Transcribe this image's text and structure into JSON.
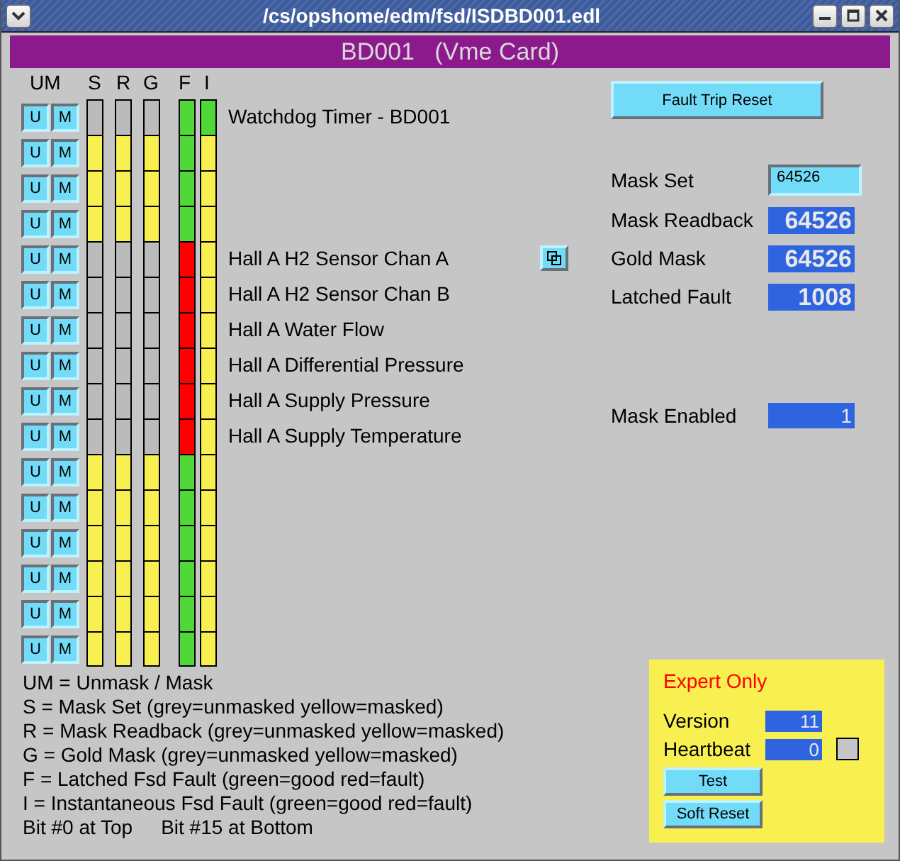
{
  "window": {
    "title": "/cs/opshome/edm/fsd/ISDBD001.edl"
  },
  "header": "BD001   (Vme Card)",
  "column_headers": [
    "UM",
    "S",
    "R",
    "G",
    "F",
    "I"
  ],
  "bits": [
    {
      "buttons": [
        "U",
        "M"
      ],
      "cells": [
        {
          "color": "#bbbbbb"
        },
        {
          "color": "#bbbbbb"
        },
        {
          "color": "#bbbbbb"
        },
        {
          "color": "#50d838"
        },
        {
          "color": "#50d838"
        }
      ],
      "label": "Watchdog Timer - BD001"
    },
    {
      "buttons": [
        "U",
        "M"
      ],
      "cells": [
        {
          "color": "#f8f050"
        },
        {
          "color": "#f8f050"
        },
        {
          "color": "#f8f050"
        },
        {
          "color": "#50d838"
        },
        {
          "color": "#f8f050"
        }
      ]
    },
    {
      "buttons": [
        "U",
        "M"
      ],
      "cells": [
        {
          "color": "#f8f050"
        },
        {
          "color": "#f8f050"
        },
        {
          "color": "#f8f050"
        },
        {
          "color": "#50d838"
        },
        {
          "color": "#f8f050"
        }
      ]
    },
    {
      "buttons": [
        "U",
        "M"
      ],
      "cells": [
        {
          "color": "#f8f050"
        },
        {
          "color": "#f8f050"
        },
        {
          "color": "#f8f050"
        },
        {
          "color": "#50d838"
        },
        {
          "color": "#f8f050"
        }
      ]
    },
    {
      "buttons": [
        "U",
        "M"
      ],
      "cells": [
        {
          "color": "#bbbbbb"
        },
        {
          "color": "#bbbbbb"
        },
        {
          "color": "#bbbbbb"
        },
        {
          "color": "#ff0000"
        },
        {
          "color": "#f8f050"
        }
      ],
      "label": "Hall A H2 Sensor Chan A",
      "display_button": true
    },
    {
      "buttons": [
        "U",
        "M"
      ],
      "cells": [
        {
          "color": "#bbbbbb"
        },
        {
          "color": "#bbbbbb"
        },
        {
          "color": "#bbbbbb"
        },
        {
          "color": "#ff0000"
        },
        {
          "color": "#f8f050"
        }
      ],
      "label": "Hall A H2 Sensor Chan B"
    },
    {
      "buttons": [
        "U",
        "M"
      ],
      "cells": [
        {
          "color": "#bbbbbb"
        },
        {
          "color": "#bbbbbb"
        },
        {
          "color": "#bbbbbb"
        },
        {
          "color": "#ff0000"
        },
        {
          "color": "#f8f050"
        }
      ],
      "label": "Hall A Water Flow"
    },
    {
      "buttons": [
        "U",
        "M"
      ],
      "cells": [
        {
          "color": "#bbbbbb"
        },
        {
          "color": "#bbbbbb"
        },
        {
          "color": "#bbbbbb"
        },
        {
          "color": "#ff0000"
        },
        {
          "color": "#f8f050"
        }
      ],
      "label": "Hall A Differential Pressure"
    },
    {
      "buttons": [
        "U",
        "M"
      ],
      "cells": [
        {
          "color": "#bbbbbb"
        },
        {
          "color": "#bbbbbb"
        },
        {
          "color": "#bbbbbb"
        },
        {
          "color": "#ff0000"
        },
        {
          "color": "#f8f050"
        }
      ],
      "label": "Hall A Supply Pressure"
    },
    {
      "buttons": [
        "U",
        "M"
      ],
      "cells": [
        {
          "color": "#bbbbbb"
        },
        {
          "color": "#bbbbbb"
        },
        {
          "color": "#bbbbbb"
        },
        {
          "color": "#ff0000"
        },
        {
          "color": "#f8f050"
        }
      ],
      "label": "Hall A Supply Temperature"
    },
    {
      "buttons": [
        "U",
        "M"
      ],
      "cells": [
        {
          "color": "#f8f050"
        },
        {
          "color": "#f8f050"
        },
        {
          "color": "#f8f050"
        },
        {
          "color": "#50d838"
        },
        {
          "color": "#f8f050"
        }
      ]
    },
    {
      "buttons": [
        "U",
        "M"
      ],
      "cells": [
        {
          "color": "#f8f050"
        },
        {
          "color": "#f8f050"
        },
        {
          "color": "#f8f050"
        },
        {
          "color": "#50d838"
        },
        {
          "color": "#f8f050"
        }
      ]
    },
    {
      "buttons": [
        "U",
        "M"
      ],
      "cells": [
        {
          "color": "#f8f050"
        },
        {
          "color": "#f8f050"
        },
        {
          "color": "#f8f050"
        },
        {
          "color": "#50d838"
        },
        {
          "color": "#f8f050"
        }
      ]
    },
    {
      "buttons": [
        "U",
        "M"
      ],
      "cells": [
        {
          "color": "#f8f050"
        },
        {
          "color": "#f8f050"
        },
        {
          "color": "#f8f050"
        },
        {
          "color": "#50d838"
        },
        {
          "color": "#f8f050"
        }
      ]
    },
    {
      "buttons": [
        "U",
        "M"
      ],
      "cells": [
        {
          "color": "#f8f050"
        },
        {
          "color": "#f8f050"
        },
        {
          "color": "#f8f050"
        },
        {
          "color": "#50d838"
        },
        {
          "color": "#f8f050"
        }
      ]
    },
    {
      "buttons": [
        "U",
        "M"
      ],
      "cells": [
        {
          "color": "#f8f050"
        },
        {
          "color": "#f8f050"
        },
        {
          "color": "#f8f050"
        },
        {
          "color": "#50d838"
        },
        {
          "color": "#f8f050"
        }
      ]
    }
  ],
  "fault_trip_reset": "Fault Trip Reset",
  "mask_set": {
    "label": "Mask Set",
    "value": "64526"
  },
  "readouts": [
    {
      "label": "Mask Readback",
      "value": "64526"
    },
    {
      "label": "Gold Mask",
      "value": "64526"
    },
    {
      "label": "Latched Fault",
      "value": "1008"
    }
  ],
  "mask_enabled": {
    "label": "Mask Enabled",
    "value": "1"
  },
  "legend": [
    "UM = Unmask / Mask",
    "S = Mask Set (grey=unmasked yellow=masked)",
    "R = Mask Readback (grey=unmasked yellow=masked)",
    "G = Gold Mask (grey=unmasked yellow=masked)",
    "F = Latched Fsd Fault (green=good red=fault)",
    "I = Instantaneous Fsd Fault (green=good red=fault)"
  ],
  "bit_notes": [
    "Bit #0 at Top",
    "Bit #15 at Bottom"
  ],
  "expert": {
    "title": "Expert Only",
    "version": {
      "label": "Version",
      "value": "11"
    },
    "heartbeat": {
      "label": "Heartbeat",
      "value": "0"
    },
    "buttons": [
      "Test",
      "Soft Reset"
    ]
  }
}
